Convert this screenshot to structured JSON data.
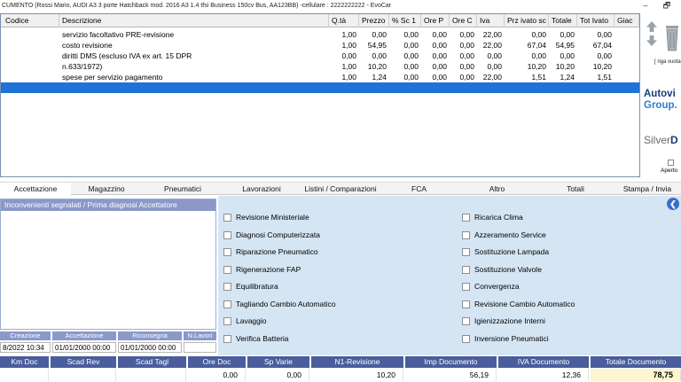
{
  "window": {
    "title": "CUMENTO (Rossi Mario, AUDI A3 3 porte Hatchback mod. 2016 A3 1.4 tfsi Business 150cv Bus, AA123BB) -cellulare : 2222222222 - EvoCar",
    "maximize_glyph": "🗗"
  },
  "grid": {
    "columns": [
      "Codice",
      "Descrizione",
      "Q.tà",
      "Prezzo",
      "% Sc 1",
      "Ore P",
      "Ore C",
      "Iva",
      "Prz ivato sc",
      "Totale",
      "Tot Ivato",
      "Giac"
    ],
    "rows": [
      [
        "",
        "servizio facoltativo PRE-revisione",
        "1,00",
        "0,00",
        "0,00",
        "0,00",
        "0,00",
        "22,00",
        "0,00",
        "0,00",
        "0,00",
        ""
      ],
      [
        "",
        "costo revisione",
        "1,00",
        "54,95",
        "0,00",
        "0,00",
        "0,00",
        "22,00",
        "67,04",
        "54,95",
        "67,04",
        ""
      ],
      [
        "",
        "diritti DMS (escluso IVA ex art. 15 DPR",
        "0,00",
        "0,00",
        "0,00",
        "0,00",
        "0,00",
        "0,00",
        "0,00",
        "0,00",
        "0,00",
        ""
      ],
      [
        "",
        "n.633/1972)",
        "1,00",
        "10,20",
        "0,00",
        "0,00",
        "0,00",
        "0,00",
        "10,20",
        "10,20",
        "10,20",
        ""
      ],
      [
        "",
        "spese per servizio pagamento",
        "1,00",
        "1,24",
        "0,00",
        "0,00",
        "0,00",
        "22,00",
        "1,51",
        "1,24",
        "1,51",
        ""
      ],
      [
        "",
        "",
        "",
        "",
        "",
        "",
        "",
        "",
        "",
        "",
        "",
        ""
      ]
    ]
  },
  "right_panel": {
    "row_label": "[ riga vuota",
    "logo_autovi": "Autovi",
    "logo_group": "Group.",
    "logo_silver": "Silver",
    "logo_silver_d": "D",
    "aperto_label": "Aperto"
  },
  "tabs": [
    "Accettazione",
    "Magazzino",
    "Pneumatici",
    "Lavorazioni",
    "Listini / Comparazioni",
    "FCA",
    "Altro",
    "Totali",
    "Stampa / Invia"
  ],
  "left_panel": {
    "header": "Inconvenienti segnalati / Prima diagnosi Accettatore"
  },
  "checklist": {
    "left": [
      "Revisione Ministeriale",
      "Diagnosi Computerizzata",
      "Riparazione Pneumatico",
      "Rigenerazione FAP",
      "Equilibratura",
      "Tagliando Cambio Automatico",
      "Lavaggio",
      "Verifica Batteria"
    ],
    "right": [
      "Ricarica Clima",
      "Azzeramento Service",
      "Sostituzione Lampada",
      "Sostituzione Valvole",
      "Convergenza",
      "Revisione Cambio Automatico",
      "Igienizzazione Interni",
      "Inversione Pneumatici"
    ]
  },
  "dates": {
    "headers": [
      "Creazione",
      "Accettazione",
      "Riconsegna",
      "N.Lavori"
    ],
    "values": [
      "8/2022 10:34",
      "01/01/2000 00:00",
      "01/01/2000 00:00",
      ""
    ]
  },
  "totals": {
    "headers": [
      "Km Doc",
      "Scad Rev",
      "Scad Tagl",
      "Ore Doc",
      "Sp Varie",
      "N1-Revisione",
      "Imp Documento",
      "IVA Documento",
      "Totale Documento"
    ],
    "values": [
      "",
      "",
      "",
      "0,00",
      "0,00",
      "10,20",
      "56,19",
      "12,36",
      "78,75"
    ]
  }
}
